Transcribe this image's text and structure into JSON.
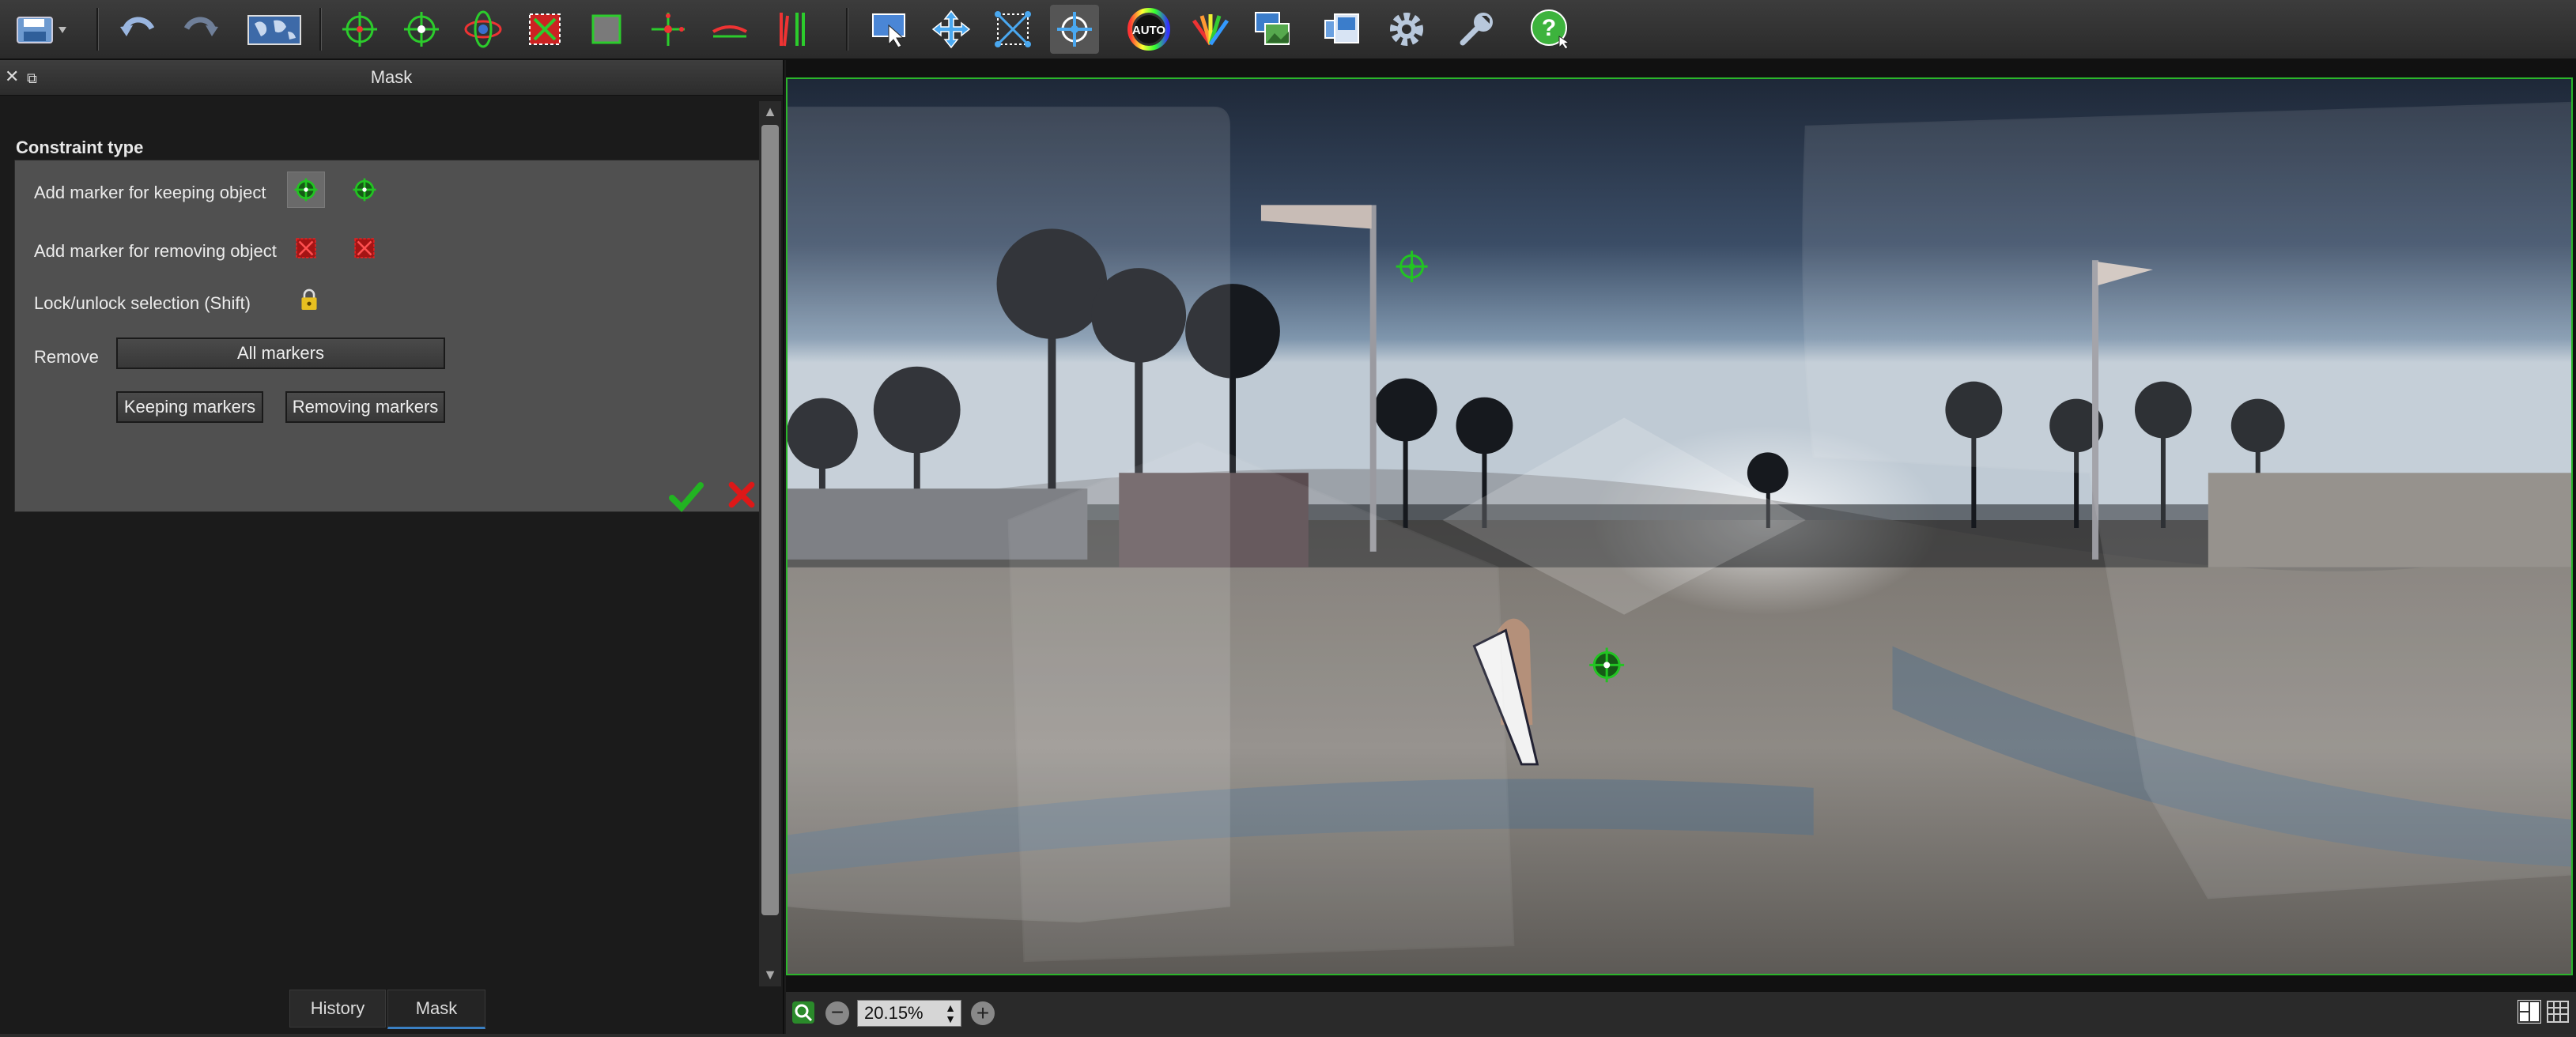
{
  "toolbar": {
    "icons": [
      "save-menu-icon",
      "undo-icon",
      "redo-icon",
      "world-map-icon",
      "target-add-icon",
      "target-icon",
      "orbit-icon",
      "crop-corners-icon",
      "select-box-icon",
      "cross-add-icon",
      "horizon-icon",
      "vertical-lines-icon",
      "select-cursor-icon",
      "move-arrows-icon",
      "grid-points-icon",
      "target-mode-icon",
      "auto-color-icon",
      "color-fan-icon",
      "image-stack-icon",
      "export-icon",
      "settings-gear-icon",
      "wrench-icon",
      "help-icon"
    ]
  },
  "panel": {
    "title": "Mask",
    "group_title": "Constraint type",
    "rows": {
      "keep_label": "Add marker for keeping object",
      "remove_label": "Add marker for removing object",
      "lock_label": "Lock/unlock selection (Shift)",
      "remove_row_label": "Remove"
    },
    "buttons": {
      "all_markers": "All markers",
      "keeping_markers": "Keeping markers",
      "removing_markers": "Removing markers"
    },
    "colors": {
      "keep": "#22c422",
      "remove": "#e22020",
      "confirm": "#22b422",
      "cancel": "#dd1818"
    }
  },
  "tabs": [
    {
      "label": "History"
    },
    {
      "label": "Mask"
    }
  ],
  "viewer": {
    "zoom_value": "20.15%",
    "border_color": "#2bb52b",
    "markers": [
      "keep-marker-flagpole",
      "keep-marker-surfer"
    ]
  }
}
